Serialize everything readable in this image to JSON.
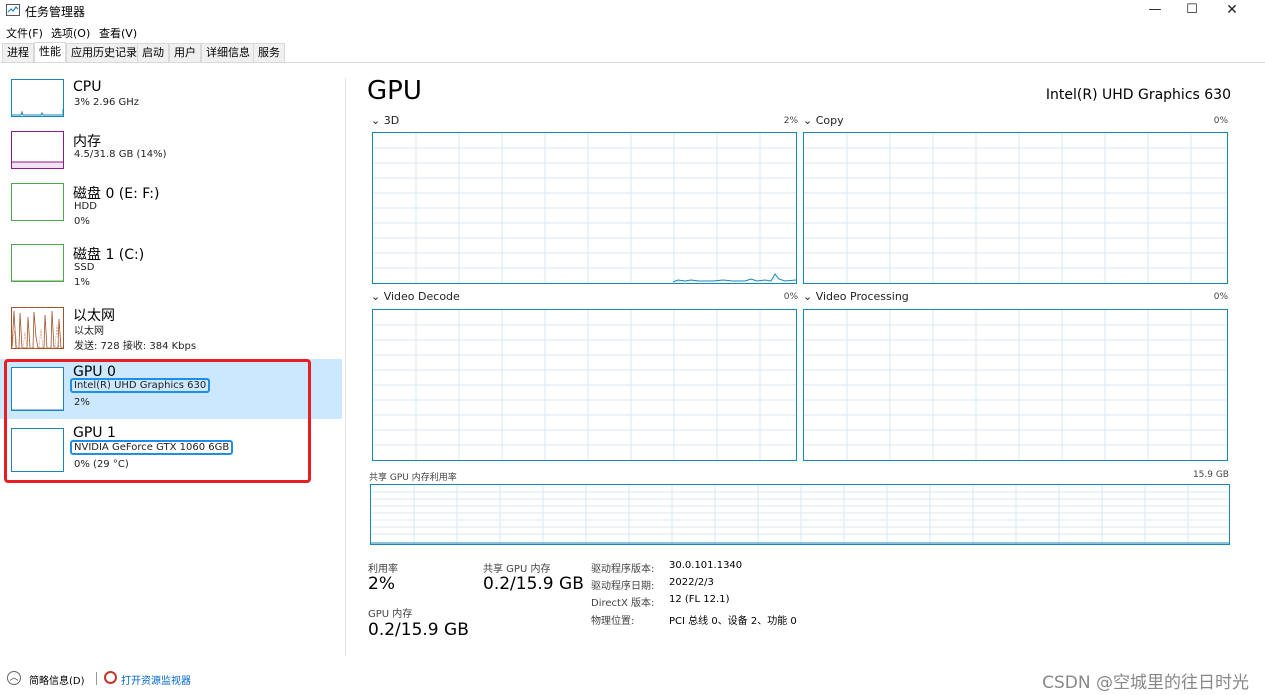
{
  "window": {
    "title": "任务管理器",
    "minimize": "—",
    "maximize": "☐",
    "close": "✕"
  },
  "menu": {
    "items": [
      "文件(F)",
      "选项(O)",
      "查看(V)"
    ]
  },
  "tabs": [
    "进程",
    "性能",
    "应用历史记录",
    "启动",
    "用户",
    "详细信息",
    "服务"
  ],
  "active_tab": "性能",
  "sidebar": {
    "items": [
      {
        "title": "CPU",
        "line1": "3% 2.96 GHz",
        "line2": "",
        "color": "#1787b8"
      },
      {
        "title": "内存",
        "line1": "4.5/31.8 GB (14%)",
        "line2": "",
        "color": "#8b1a8b"
      },
      {
        "title": "磁盘 0 (E: F:)",
        "line1": "HDD",
        "line2": "0%",
        "color": "#4da74d"
      },
      {
        "title": "磁盘 1 (C:)",
        "line1": "SSD",
        "line2": "1%",
        "color": "#4da74d"
      },
      {
        "title": "以太网",
        "line1": "以太网",
        "line2": "发送: 728 接收: 384 Kbps",
        "color": "#a0522d"
      },
      {
        "title": "GPU 0",
        "line1": "Intel(R) UHD Graphics 630",
        "line2": "2%",
        "color": "#1787b8"
      },
      {
        "title": "GPU 1",
        "line1": "NVIDIA GeForce GTX 1060 6GB",
        "line2": "0% (29 °C)",
        "color": "#1787b8"
      }
    ]
  },
  "main": {
    "title": "GPU",
    "model": "Intel(R) UHD Graphics 630",
    "graphs": [
      {
        "label": "3D",
        "percent": "2%"
      },
      {
        "label": "Copy",
        "percent": "0%"
      },
      {
        "label": "Video Decode",
        "percent": "0%"
      },
      {
        "label": "Video Processing",
        "percent": "0%"
      }
    ],
    "shared_memory_label": "共享 GPU 内存利用率",
    "shared_memory_capacity": "15.9 GB",
    "stats": {
      "utilization_label": "利用率",
      "utilization_value": "2%",
      "shared_mem_label": "共享 GPU 内存",
      "shared_mem_value": "0.2/15.9 GB",
      "gpu_mem_label": "GPU 内存",
      "gpu_mem_value": "0.2/15.9 GB"
    },
    "info": [
      {
        "key": "驱动程序版本:",
        "value": "30.0.101.1340"
      },
      {
        "key": "驱动程序日期:",
        "value": "2022/2/3"
      },
      {
        "key": "DirectX 版本:",
        "value": "12 (FL 12.1)"
      },
      {
        "key": "物理位置:",
        "value": "PCI 总线 0、设备 2、功能 0"
      }
    ]
  },
  "footer": {
    "fewer_details": "简略信息(D)",
    "open_monitor": "打开资源监视器",
    "watermark": "CSDN @空城里的往日时光"
  },
  "colors": {
    "accent": "#1787b8",
    "selected_bg": "#cce8ff",
    "highlight_box": "#1e8ee6",
    "red_annotation": "#e81e25"
  }
}
